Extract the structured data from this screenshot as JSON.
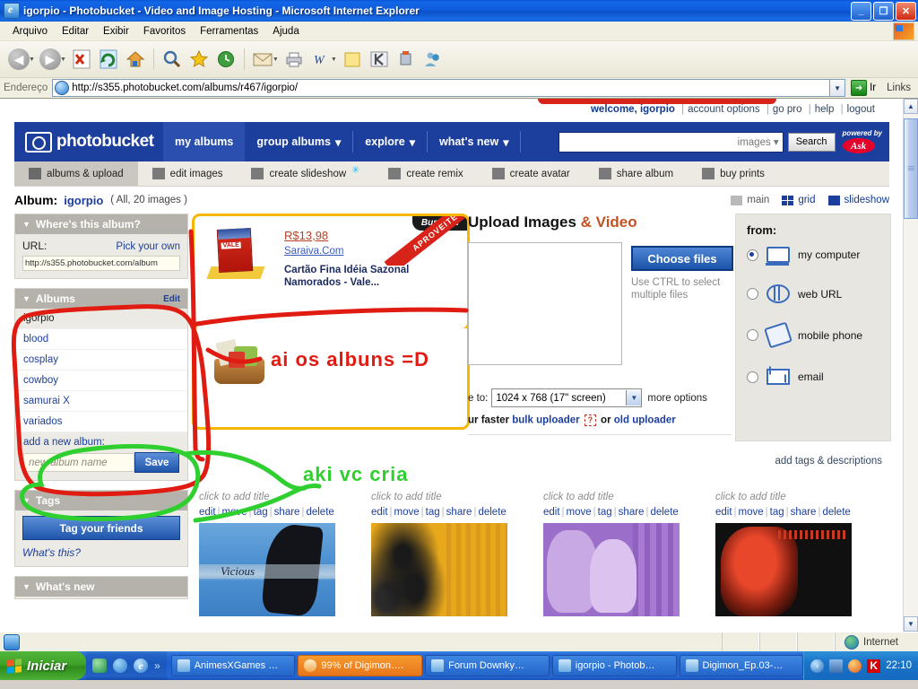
{
  "window": {
    "title": "igorpio - Photobucket - Video and Image Hosting - Microsoft Internet Explorer",
    "minimize": "_",
    "maximize": "❐",
    "close": "✕"
  },
  "menu": {
    "items": [
      "Arquivo",
      "Editar",
      "Exibir",
      "Favoritos",
      "Ferramentas",
      "Ajuda"
    ]
  },
  "toolbar": {
    "back": "←",
    "forward": "→",
    "stop": "✖",
    "refresh": "⟳",
    "home": "⌂",
    "search": "🔍",
    "favorites": "★",
    "history": "🕘",
    "mail": "✉",
    "print": "🖨",
    "word": "W",
    "notes": "▭",
    "kaspersky": "K",
    "messenger": "👥",
    "extra": "🔗"
  },
  "address": {
    "label": "Endereço",
    "url": "http://s355.photobucket.com/albums/r467/igorpio/",
    "go": "Ir",
    "links": "Links"
  },
  "account_bar": {
    "welcome": "welcome, igorpio",
    "links": [
      "account options",
      "go pro",
      "help",
      "logout"
    ]
  },
  "brand": {
    "name": "photobucket"
  },
  "mainnav": {
    "items": [
      {
        "label": "my albums",
        "caret": ""
      },
      {
        "label": "group albums",
        "caret": "▾"
      },
      {
        "label": "explore",
        "caret": "▾"
      },
      {
        "label": "what's new",
        "caret": "▾"
      }
    ],
    "search_filter": "images ▾",
    "search_button": "Search",
    "powered_by": "powered by",
    "ask": "Ask"
  },
  "subnav": {
    "items": [
      {
        "label": "albums & upload",
        "icon": "albums-icon",
        "active": true
      },
      {
        "label": "edit images",
        "icon": "edit-image-icon",
        "active": false
      },
      {
        "label": "create slideshow",
        "icon": "slideshow-icon",
        "active": false
      },
      {
        "label": "create remix",
        "icon": "remix-icon",
        "active": false
      },
      {
        "label": "create avatar",
        "icon": "avatar-icon",
        "active": false
      },
      {
        "label": "share album",
        "icon": "share-icon",
        "active": false
      },
      {
        "label": "buy prints",
        "icon": "prints-icon",
        "active": false
      }
    ]
  },
  "album_header": {
    "label": "Album:",
    "name": "igorpio",
    "count": "( All, 20 images )",
    "views": [
      {
        "label": "main",
        "active": false
      },
      {
        "label": "grid",
        "active": true
      },
      {
        "label": "slideshow",
        "active": true
      }
    ]
  },
  "sidebar": {
    "where_panel": {
      "title": "Where's this album?",
      "url_label": "URL:",
      "pick_link": "Pick your own",
      "url_value": "http://s355.photobucket.com/album"
    },
    "albums_panel": {
      "title": "Albums",
      "edit": "Edit",
      "items": [
        {
          "label": "igorpio",
          "current": true
        },
        {
          "label": "blood",
          "current": false
        },
        {
          "label": "cosplay",
          "current": false
        },
        {
          "label": "cowboy",
          "current": false
        },
        {
          "label": "samurai X",
          "current": false
        },
        {
          "label": "variados",
          "current": false
        }
      ],
      "add_new": "add a new album:",
      "new_placeholder": "new album name",
      "save_label": "Save"
    },
    "tags_panel": {
      "title": "Tags",
      "button": "Tag your friends",
      "whats_this": "What's this?"
    },
    "whats_new_panel": {
      "title": "What's new"
    }
  },
  "ad": {
    "price": "R$13,98",
    "site": "Saraiva.Com",
    "description": "Cartão Fina Idéia Sazonal Namorados - Vale...",
    "ribbon": "APROVEITE",
    "brand": "BuscaPé"
  },
  "upload": {
    "title_main": "Upload Images",
    "title_accent": "& Video",
    "choose_files": "Choose files",
    "ctrl_hint": "Use CTRL to select multiple files",
    "resize_label": "e to:",
    "resize_value": "1024 x 768 (17\" screen)",
    "more_options": "more options",
    "links_prefix": "ur faster",
    "bulk_uploader": "bulk uploader",
    "question": "?",
    "links_middle": "or",
    "old_uploader": "old uploader"
  },
  "from_panel": {
    "title": "from:",
    "options": [
      {
        "label": "my computer",
        "icon": "computer-icon",
        "selected": true
      },
      {
        "label": "web URL",
        "icon": "globe-icon",
        "selected": false
      },
      {
        "label": "mobile phone",
        "icon": "phone-icon",
        "selected": false
      },
      {
        "label": "email",
        "icon": "envelope-icon",
        "selected": false
      }
    ]
  },
  "tags_descriptions_link": "add tags & descriptions",
  "thumbnails": [
    {
      "title": "click to add title",
      "actions": [
        "edit",
        "move",
        "tag",
        "share",
        "delete"
      ],
      "caption": "Vicious"
    },
    {
      "title": "click to add title",
      "actions": [
        "edit",
        "move",
        "tag",
        "share",
        "delete"
      ],
      "caption": ""
    },
    {
      "title": "click to add title",
      "actions": [
        "edit",
        "move",
        "tag",
        "share",
        "delete"
      ],
      "caption": ""
    },
    {
      "title": "click to add title",
      "actions": [
        "edit",
        "move",
        "tag",
        "share",
        "delete"
      ],
      "caption": ""
    }
  ],
  "annotations": {
    "red_text": "ai os albuns =D",
    "red_color": "#e01b12",
    "green_text": "aki vc cria",
    "green_color": "#2fcf2f"
  },
  "statusbar": {
    "zone": "Internet"
  },
  "taskbar": {
    "start": "Iniciar",
    "quicklaunch": [
      "show-desktop-icon",
      "messenger-icon",
      "internet-explorer-icon",
      "chevron-icon"
    ],
    "tasks": [
      {
        "label": "AnimesXGames …",
        "active": false
      },
      {
        "label": "99% of Digimon….",
        "active": true
      },
      {
        "label": "Forum Downky…",
        "active": false
      },
      {
        "label": "igorpio - Photob…",
        "active": false
      },
      {
        "label": "Digimon_Ep.03-…",
        "active": false
      }
    ],
    "clock": "22:10"
  }
}
